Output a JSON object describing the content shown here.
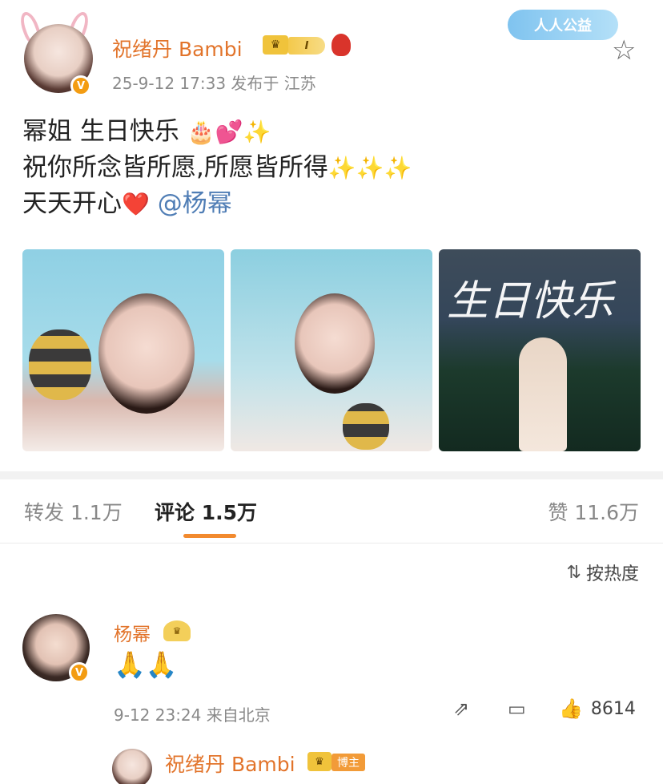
{
  "post": {
    "author": "祝绪丹 Bambi",
    "level_badge": "I",
    "timestamp": "25-9-12 17:33",
    "location": "发布于 江苏",
    "charity_badge": "人人公益",
    "lines": [
      {
        "text": "幂姐 生日快乐",
        "emoji": "🎂💕✨"
      },
      {
        "text": "祝你所念皆所愿,所愿皆所得",
        "emoji": "✨✨✨"
      },
      {
        "text": "天天开心",
        "emoji": "❤️"
      }
    ],
    "mention": "@杨幂",
    "photo3_script": "生日快乐"
  },
  "tabs": {
    "repost": "转发 1.1万",
    "comments": "评论 1.5万",
    "likes": "赞 11.6万"
  },
  "sort": {
    "label": "按热度",
    "icon": "sort-icon"
  },
  "comment": {
    "author": "杨幂",
    "body": "🙏🙏",
    "time": "9-12 23:24",
    "location": "来自北京",
    "likes": "8614"
  },
  "reply": {
    "author": "祝绪丹 Bambi",
    "badge": "博主"
  },
  "colors": {
    "accent": "#e2742b",
    "tab_underline": "#f28a2e",
    "mention": "#4f7db5",
    "vip_gold": "#f0c33b"
  }
}
